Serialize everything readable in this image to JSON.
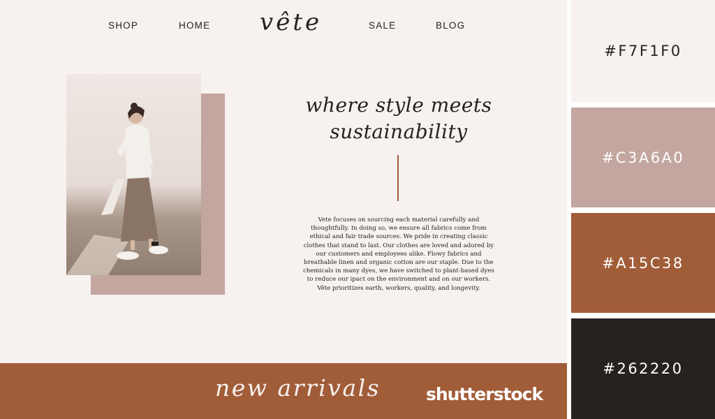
{
  "nav": {
    "items": [
      "SHOP",
      "HOME",
      "SALE",
      "BLOG"
    ],
    "logo": "vête"
  },
  "hero": {
    "headline_line1": "where style meets",
    "headline_line2": "sustainability",
    "body": "Vete focuses on sourcing each material carefully and thoughtfully. In doing so, we ensure all fabrics come from ethical and fair trade sources. We pride in creating classic clothes that stand to last. Our clothes are loved and adored by our customers and employees alike. Flowy fabrics and breathable linen and organic cotton are our staple. Due to the chemicals in many dyes, we have switched to plant-based dyes to reduce our ipact on the environment and on our workers. Vête prioritizes earth, workers, quality, and longevity."
  },
  "banner": {
    "title": "new arrivals",
    "watermark": "shutterstock"
  },
  "palette": [
    {
      "hex": "#F7F1F0",
      "text_color": "#262220"
    },
    {
      "hex": "#C3A6A0",
      "text_color": "#FFFFFF"
    },
    {
      "hex": "#A15C38",
      "text_color": "#FFFFFF"
    },
    {
      "hex": "#262220",
      "text_color": "#FFFFFF"
    }
  ]
}
